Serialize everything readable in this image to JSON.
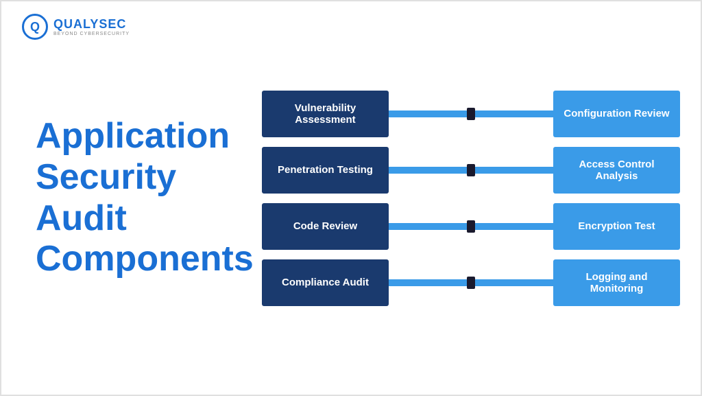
{
  "logo": {
    "name": "QUALYSEC",
    "tagline": "BEYOND CYBERSECURITY"
  },
  "title": {
    "line1": "Application",
    "line2": "Security",
    "line3": "Audit",
    "line4": "Components"
  },
  "rows": [
    {
      "left": "Vulnerability Assessment",
      "right": "Configuration Review"
    },
    {
      "left": "Penetration Testing",
      "right": "Access Control Analysis"
    },
    {
      "left": "Code Review",
      "right": "Encryption Test"
    },
    {
      "left": "Compliance Audit",
      "right": "Logging and Monitoring"
    }
  ]
}
